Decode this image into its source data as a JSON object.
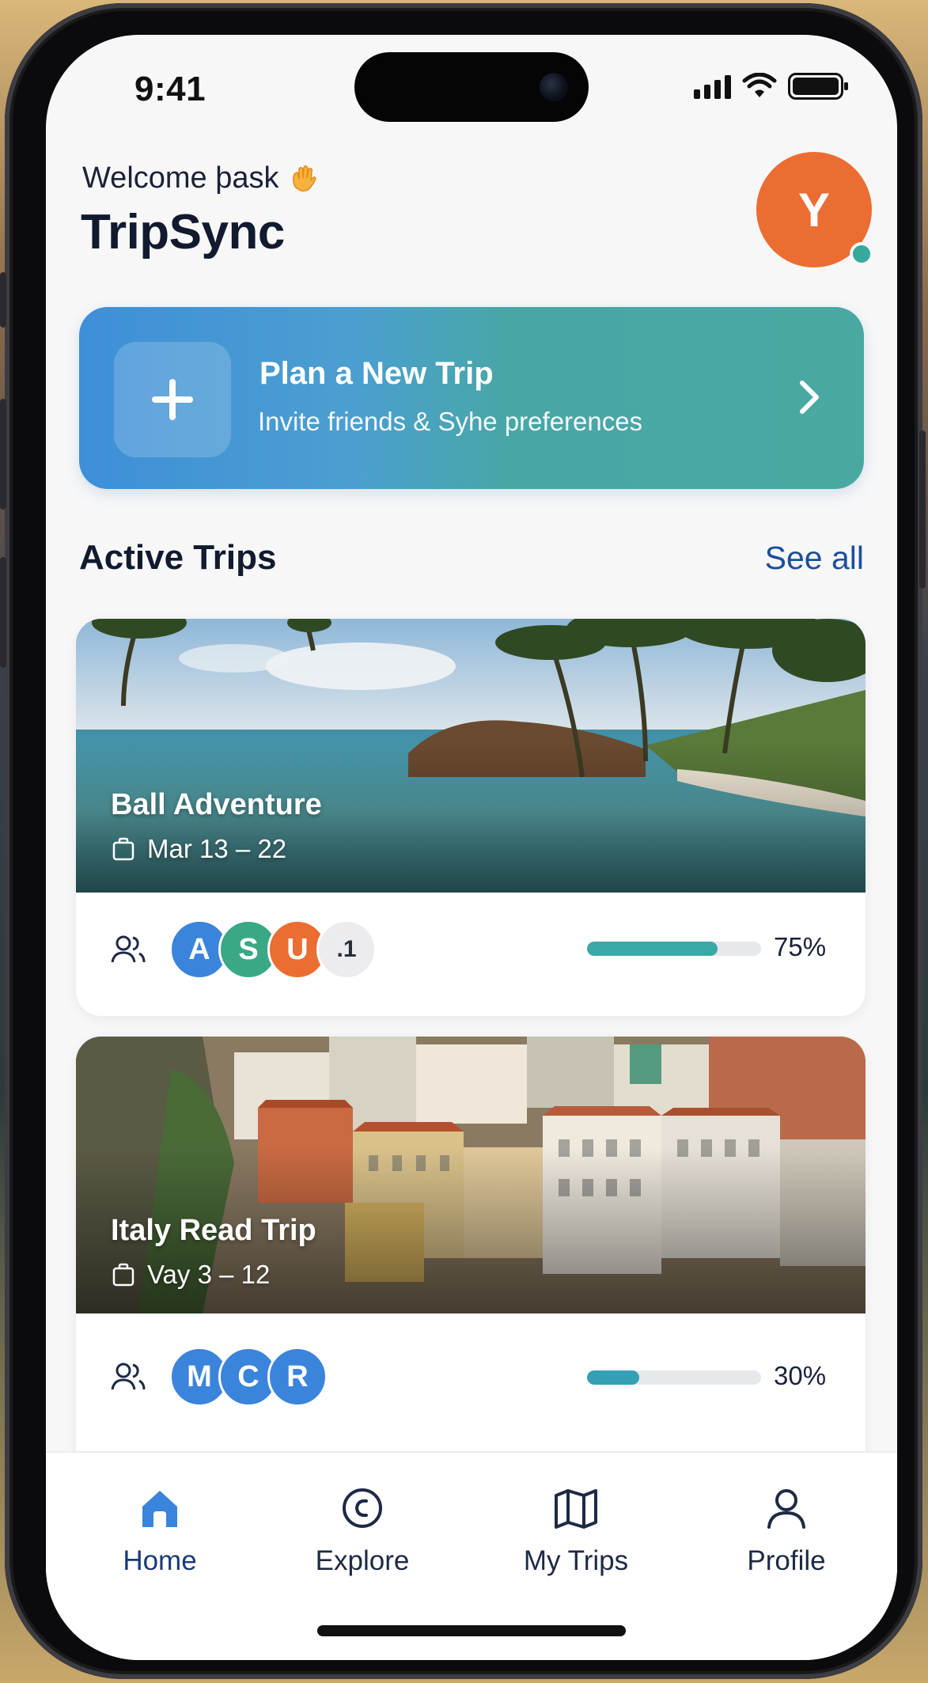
{
  "status": {
    "time": "9:41"
  },
  "header": {
    "welcome": "Welcome þask",
    "app_name": "TripSync",
    "avatar_initial": "Y"
  },
  "plan_card": {
    "title": "Plan a New Trip",
    "subtitle": "Invite friends & Syhe preferences"
  },
  "active_trips": {
    "title": "Active Trips",
    "see_all": "See all",
    "trips": [
      {
        "name": "Ball Adventure",
        "dates": "Mar 13 – 22",
        "members": [
          {
            "initial": "A",
            "color": "#3b84db"
          },
          {
            "initial": "S",
            "color": "#3aa887"
          },
          {
            "initial": "U",
            "color": "#ec6d32"
          }
        ],
        "more": ".1",
        "progress_label": "75%",
        "progress": 0.75,
        "progress_color": "#3aa8a6"
      },
      {
        "name": "Italy Read Trip",
        "dates": "Vay 3 – 12",
        "members": [
          {
            "initial": "M",
            "color": "#3b84db"
          },
          {
            "initial": "C",
            "color": "#3b84db"
          },
          {
            "initial": "R",
            "color": "#3b84db"
          }
        ],
        "progress_label": "30%",
        "progress": 0.3,
        "progress_color": "#35a0b5"
      }
    ]
  },
  "tabs": [
    {
      "label": "Home",
      "icon": "home-icon",
      "active": true
    },
    {
      "label": "Explore",
      "icon": "compass-icon",
      "active": false
    },
    {
      "label": "My Trips",
      "icon": "map-icon",
      "active": false
    },
    {
      "label": "Profile",
      "icon": "user-icon",
      "active": false
    }
  ],
  "colors": {
    "accent": "#1b4fa0",
    "avatar": "#ec6d32",
    "online": "#35a99c"
  }
}
